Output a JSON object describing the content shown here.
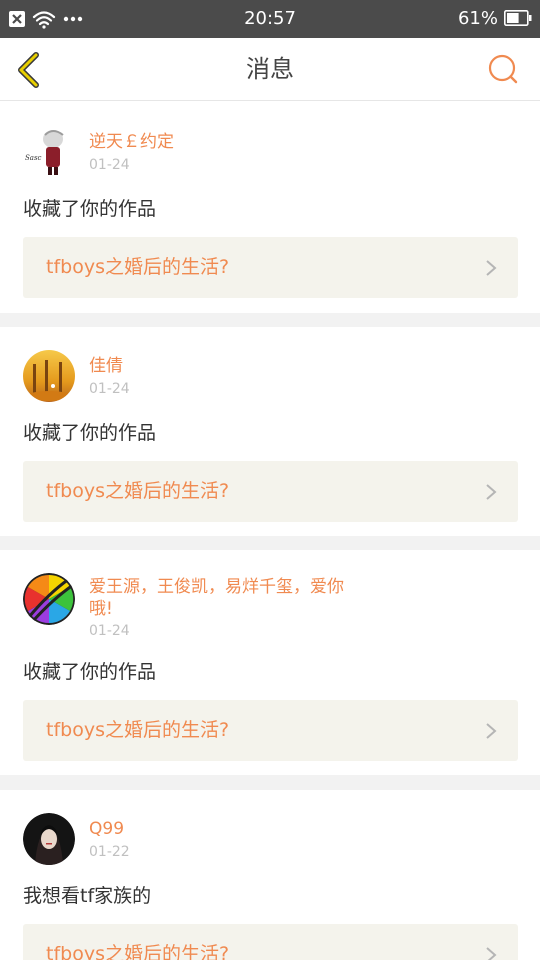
{
  "status_bar": {
    "time": "20:57",
    "battery_percent": "61%",
    "battery_level": 0.61,
    "icons": [
      "close-notification-icon",
      "wifi-icon",
      "more-dots-icon",
      "battery-icon"
    ]
  },
  "header": {
    "title": "消息",
    "back_icon": "chevron-left-icon",
    "search_icon": "search-icon"
  },
  "colors": {
    "accent": "#f08a50",
    "back_icon": "#c9b000",
    "link_bg": "#f4f3ec"
  },
  "messages": [
    {
      "username": "逆天￡约定",
      "date": "01-24",
      "action": "收藏了你的作品",
      "work_title": "tfboys之婚后的生活?"
    },
    {
      "username": "佳倩",
      "date": "01-24",
      "action": "收藏了你的作品",
      "work_title": "tfboys之婚后的生活?"
    },
    {
      "username": "爱王源，王俊凯，易烊千玺，爱你哦!",
      "date": "01-24",
      "action": "收藏了你的作品",
      "work_title": "tfboys之婚后的生活?"
    },
    {
      "username": "Q99",
      "date": "01-22",
      "action": "我想看tf家族的",
      "work_title": "tfboys之婚后的生活?"
    }
  ]
}
